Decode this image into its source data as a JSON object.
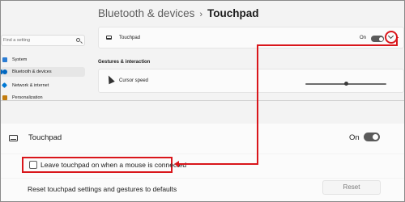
{
  "breadcrumb": {
    "parent": "Bluetooth & devices",
    "separator": "›",
    "current": "Touchpad"
  },
  "sidebar": {
    "search_placeholder": "Find a setting",
    "items": [
      {
        "label": "System",
        "icon": "monitor-icon",
        "active": false,
        "color": "#0067c0"
      },
      {
        "label": "Bluetooth & devices",
        "icon": "bluetooth-icon",
        "active": true,
        "color": "#0067c0"
      },
      {
        "label": "Network & internet",
        "icon": "wifi-icon",
        "active": false,
        "color": "#0078d4"
      },
      {
        "label": "Personalization",
        "icon": "brush-icon",
        "active": false,
        "color": "#c27c0e"
      }
    ]
  },
  "touchpad_card": {
    "title": "Touchpad",
    "toggle_state": "On"
  },
  "gestures": {
    "section_title": "Gestures & interaction",
    "cursor_speed_label": "Cursor speed",
    "cursor_speed_value": 0.5
  },
  "zoomed": {
    "title": "Touchpad",
    "toggle_state": "On",
    "checkbox_label": "Leave touchpad on when a mouse is connected",
    "checkbox_checked": false,
    "reset_label": "Reset touchpad settings and gestures to defaults",
    "reset_button": "Reset"
  },
  "colors": {
    "accent": "#0067c0",
    "annotation": "#d9161b"
  }
}
